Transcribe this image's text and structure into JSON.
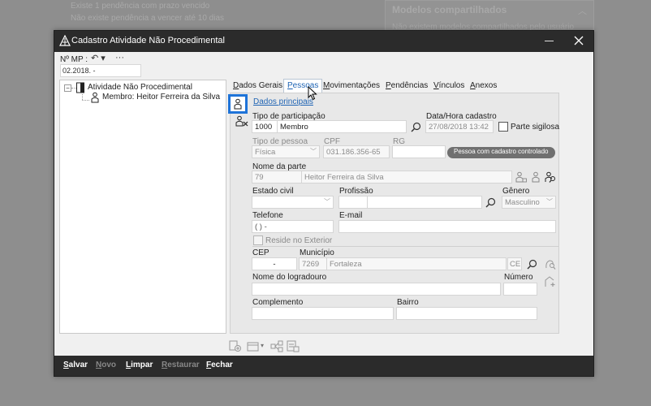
{
  "background": {
    "line1": "Existe 1 pendência com prazo vencido",
    "line2": "Não existe pendência a vencer até 10 dias",
    "panel_title": "Modelos compartilhados",
    "panel_sub": "Não existem modelos compartilhados pelo usuário"
  },
  "window": {
    "title": "Cadastro Atividade Não Procedimental",
    "mp_label": "Nº MP :",
    "mp_value": "02.2018.         -",
    "undo_symbol": "↶ ▾",
    "more_symbol": "···"
  },
  "tree": {
    "collapse_symbol": "−",
    "root": "Atividade Não Procedimental",
    "child": "Membro: Heitor Ferreira da Silva"
  },
  "tabs": [
    {
      "label": "Dados Gerais"
    },
    {
      "label": "Pessoas"
    },
    {
      "label": "Movimentações"
    },
    {
      "label": "Pendências"
    },
    {
      "label": "Vínculos"
    },
    {
      "label": "Anexos"
    }
  ],
  "form": {
    "section_link": "Dados principais",
    "tipo_participacao_label": "Tipo de participação",
    "tipo_participacao_code": "1000",
    "tipo_participacao_value": "Membro",
    "data_hora_label": "Data/Hora cadastro",
    "data_hora_value": "27/08/2018 13:42",
    "parte_sigilosa_label": "Parte sigilosa",
    "tipo_pessoa_label": "Tipo de pessoa",
    "tipo_pessoa_value": "Física",
    "cpf_label": "CPF",
    "cpf_value": "031.186.356-65",
    "rg_label": "RG",
    "rg_value": "",
    "pill_label": "Pessoa com cadastro controlado",
    "nome_label": "Nome da parte",
    "nome_code": "79",
    "nome_value": "Heitor Ferreira da Silva",
    "estado_civil_label": "Estado civil",
    "estado_civil_value": "",
    "profissao_label": "Profissão",
    "profissao_value": "",
    "genero_label": "Gênero",
    "genero_value": "Masculino",
    "telefone_label": "Telefone",
    "telefone_value": "(  )     -",
    "email_label": "E-mail",
    "email_value": "",
    "reside_exterior_label": "Reside no Exterior",
    "cep_label": "CEP",
    "cep_value": "-",
    "municipio_label": "Município",
    "municipio_code": "7269",
    "municipio_value": "Fortaleza",
    "uf_value": "CE",
    "logradouro_label": "Nome do logradouro",
    "logradouro_value": "",
    "numero_label": "Número",
    "numero_value": "",
    "complemento_label": "Complemento",
    "complemento_value": "",
    "bairro_label": "Bairro",
    "bairro_value": ""
  },
  "footer": {
    "salvar": "Salvar",
    "novo": "Novo",
    "limpar": "Limpar",
    "restaurar": "Restaurar",
    "fechar": "Fechar"
  },
  "colors": {
    "accent": "#1e73d8",
    "titlebar": "#2b2b2b",
    "link": "#1f64b4"
  }
}
